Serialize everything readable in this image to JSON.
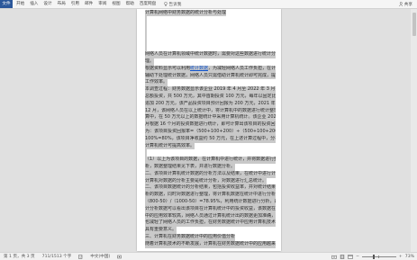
{
  "ribbon": {
    "file_tab": "文件",
    "tabs": [
      "开始",
      "插入",
      "设计",
      "布局",
      "引用",
      "邮件",
      "审阅",
      "视图",
      "帮助",
      "百度网盘"
    ],
    "tell_me": "告诉我",
    "share": "共享"
  },
  "document": {
    "lines": [
      "计算机网络中财务数据的统计分析与处理",
      "",
      "",
      "",
      "",
      "",
      "网络人员在计算机领域中统计数据时，需要对这些数据进行统计分析和处",
      "理。",
      {
        "before": "根据资料显示可以利用",
        "link": "统计数据",
        "after": "，为减轻网络人员工作负担，在计算机"
      },
      "辅助下处理统计数据，网络人员只需借助计算机统计即可完成，提高了",
      "工作效率。",
      "本调查过程：财务数据显示该企业 2019 年 4 月至 2022 年 3 月投资项目",
      "总额投资，共 500 万元，其中首期投资 100 万元，每年以固定比例",
      "追加 200 万元，该产品投资项目预计回报为 200 万元，2021 年",
      "12 月，该网络人员在以上统计中，将计算机中的数据进行统计整理，计",
      "算中，在 50 万元以上的数据统计中采用计算机统计。该企业 2022 年 4",
      "月根据 16 个月的投资数据进行统计，即可计算出该项目的投资回报比",
      "为：该项目投资回报率=（500+100+200）÷（500+100+200+200）×",
      "100%=80%，该项目净收益约 50 万元，在上述计算过程中，分析中",
      "计算机统计可提高效率。",
      "",
      "（1）以上为该项目的数据，在计算机中进行统计，并将数据进行整理分",
      "析，数据整理结果见下表，并进行数据分析。",
      "二、该项目计算机统计数据的分析方法以及结果，在统计中进行计算，",
      "计算机对数据的分析主要是统计分析，对数据进行汇总统计。",
      "二、该项目数据统计的分析结果，包括投资收益率，并对统计结果进行分",
      "析的数据，同时对数据进行整理，将计算机数据在统计中进行分析，即",
      "（800-50）/（1000-50）=78.95%，利用统计数据进行分析，由计算机统",
      "计分析数据可以看出该项目在计算机统计中的投资收益，该数据在统计",
      "中的应用效率较高，网络人员通过计算机统计出的数据更加准确，同时",
      "也减轻了网络人员的工作负担，在财务数据统计中应用计算机技术",
      "具有重要意义。",
      "三、计算机在财务数据统计中的应用价值分析",
      "随着计算机技术的不断发展，计算机在财务数据统计中的应用越来越广"
    ]
  },
  "status_bar": {
    "page": "第 1 页，共 3 页",
    "words": "711/1513 个字",
    "language": "中文(中国)",
    "zoom_out": "−",
    "zoom_in": "+",
    "zoom_level": "73%",
    "zoom_percent": 73
  },
  "icons": {
    "tell_me": "lightbulb-icon",
    "share": "person-icon",
    "proofing": "proofing-icon",
    "macro": "macro-icon",
    "views": [
      "read-mode-icon",
      "print-layout-icon",
      "web-layout-icon"
    ]
  },
  "colors": {
    "file_tab": "#2b579a",
    "selection": "#c9c9c9",
    "link": "#1155cc",
    "canvas": "#e0e0e0"
  }
}
